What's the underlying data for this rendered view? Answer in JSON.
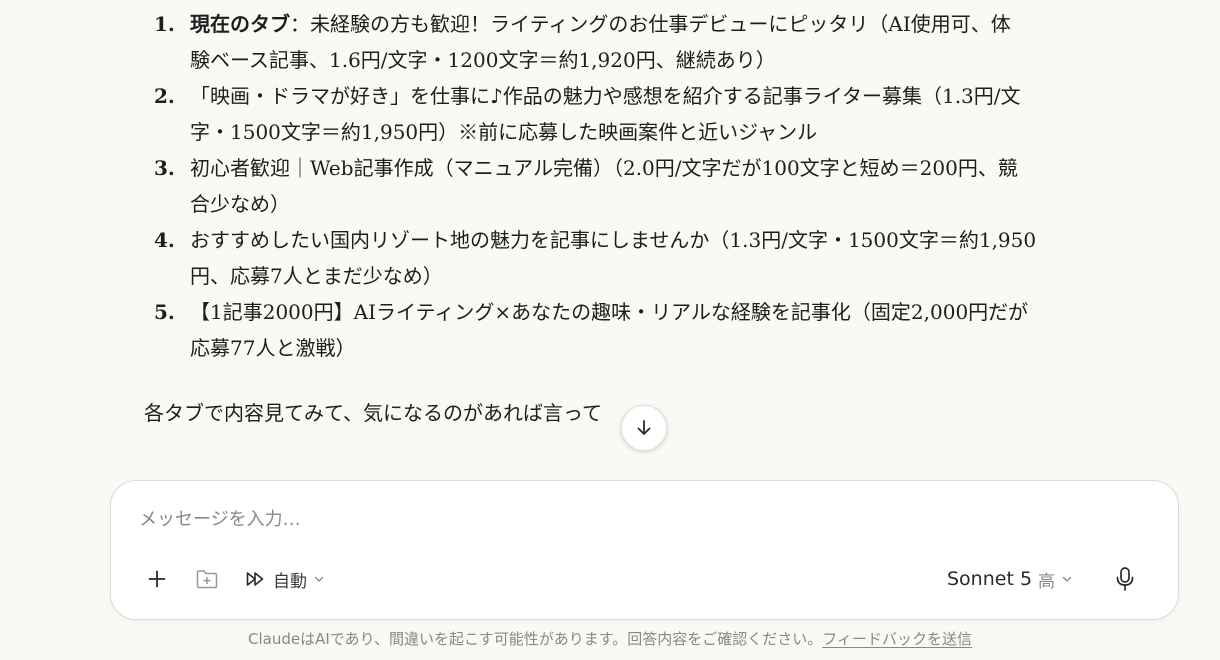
{
  "conversation": {
    "items": [
      {
        "number": "1.",
        "title": "現在のタブ",
        "line1_rest": "：未経験の方も歓迎！ライティングのお仕事デビューにピッタリ（AI使用可、体",
        "line2": "験ベース記事、1.6円/文字・1200文字＝約1,920円、継続あり）"
      },
      {
        "number": "2.",
        "line1": "「映画・ドラマが好き」を仕事に♪作品の魅力や感想を紹介する記事ライター募集（1.3円/文",
        "line2": "字・1500文字＝約1,950円）※前に応募した映画案件と近いジャンル"
      },
      {
        "number": "3.",
        "line1": "初心者歓迎｜Web記事作成（マニュアル完備）（2.0円/文字だが100文字と短め＝200円、競",
        "line2": "合少なめ）"
      },
      {
        "number": "4.",
        "line1": "おすすめしたい国内リゾート地の魅力を記事にしませんか（1.3円/文字・1500文字＝約1,950",
        "line2": "円、応募7人とまだ少なめ）"
      },
      {
        "number": "5.",
        "line1": "【1記事2000円】AIライティング×あなたの趣味・リアルな経験を記事化（固定2,000円だが",
        "line2": "応募77人と激戦）"
      }
    ],
    "closing_text": "各タブで内容見てみて、気になるのがあれば言って"
  },
  "composer": {
    "placeholder": "メッセージを入力…",
    "style_label": "自動",
    "model_name": "Sonnet 5",
    "model_effort": "高"
  },
  "footer": {
    "disclaimer": "ClaudeはAIであり、間違いを起こす可能性があります。回答内容をご確認ください。",
    "feedback_link": "フィードバックを送信"
  },
  "icons": {
    "scroll": "arrow-down-icon",
    "plus": "plus-icon",
    "project": "folder-plus-icon",
    "style": "fast-forward-icon",
    "dropdown": "chevron-down-icon",
    "mic": "microphone-icon"
  }
}
